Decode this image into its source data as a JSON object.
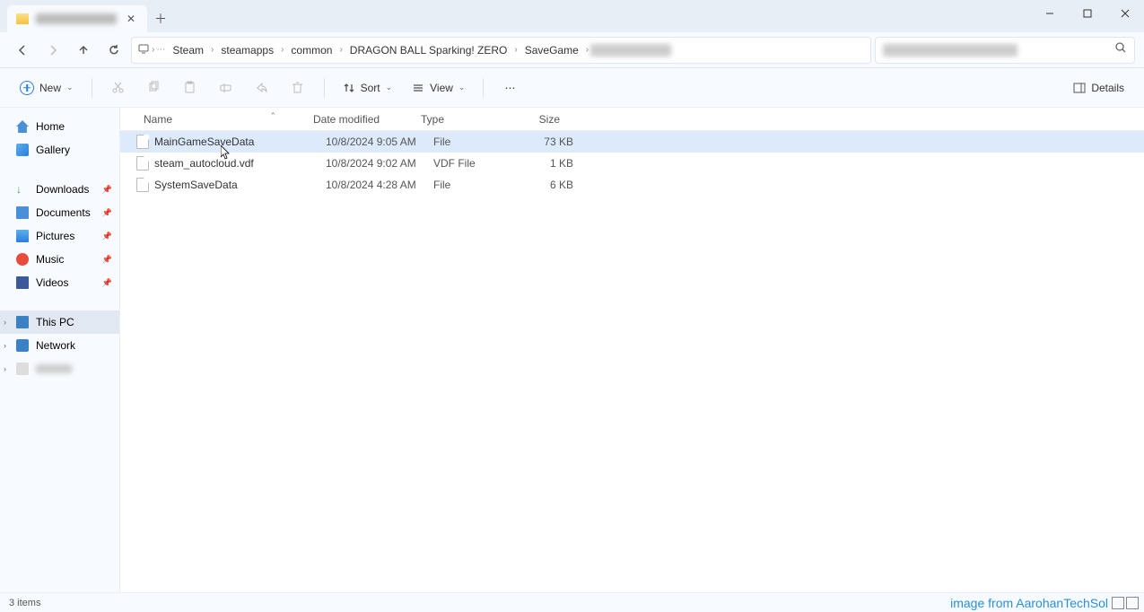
{
  "window": {
    "tab_title_redacted": true,
    "minimize": "—",
    "maximize": "☐",
    "close": "✕"
  },
  "nav": {
    "breadcrumbs": [
      "Steam",
      "steamapps",
      "common",
      "DRAGON BALL Sparking! ZERO",
      "SaveGame"
    ],
    "last_redacted": true
  },
  "toolbar": {
    "new": "New",
    "sort": "Sort",
    "view": "View",
    "details": "Details"
  },
  "sidebar": {
    "home": "Home",
    "gallery": "Gallery",
    "quick": [
      "Downloads",
      "Documents",
      "Pictures",
      "Music",
      "Videos"
    ],
    "thispc": "This PC",
    "network": "Network"
  },
  "columns": {
    "name": "Name",
    "date": "Date modified",
    "type": "Type",
    "size": "Size"
  },
  "files": [
    {
      "name": "MainGameSaveData",
      "date": "10/8/2024 9:05 AM",
      "type": "File",
      "size": "73 KB",
      "selected": true
    },
    {
      "name": "steam_autocloud.vdf",
      "date": "10/8/2024 9:02 AM",
      "type": "VDF File",
      "size": "1 KB",
      "selected": false
    },
    {
      "name": "SystemSaveData",
      "date": "10/8/2024 4:28 AM",
      "type": "File",
      "size": "6 KB",
      "selected": false
    }
  ],
  "status": {
    "count": "3 items",
    "watermark": "image from AarohanTechSol"
  }
}
